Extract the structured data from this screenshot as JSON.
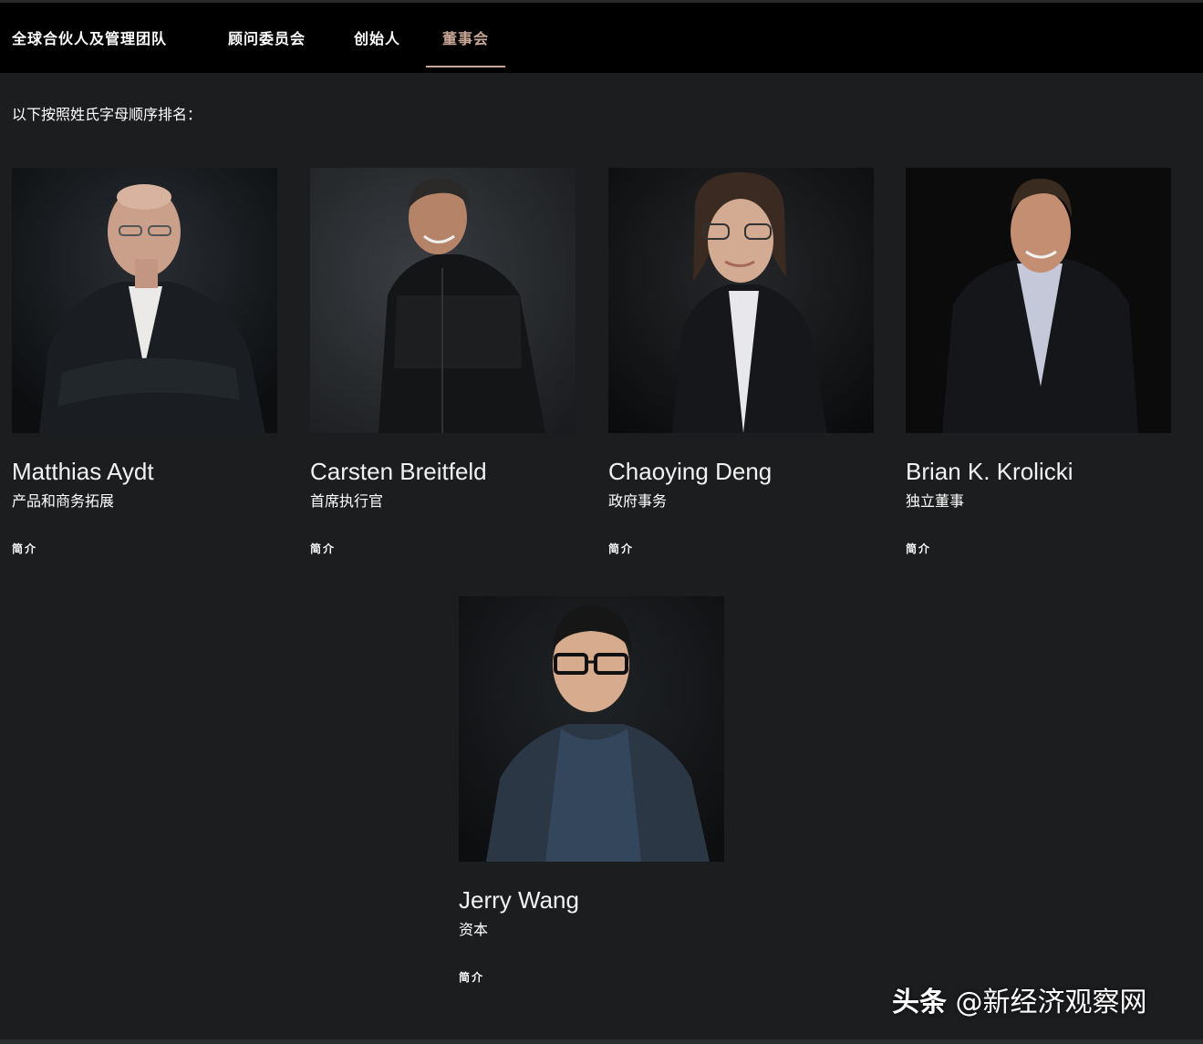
{
  "nav": {
    "tabs": [
      {
        "label": "全球合伙人及管理团队",
        "active": false
      },
      {
        "label": "顾问委员会",
        "active": false
      },
      {
        "label": "创始人",
        "active": false
      },
      {
        "label": "董事会",
        "active": true
      }
    ],
    "accent_color": "#c9a796"
  },
  "intro": "以下按照姓氏字母顺序排名：",
  "members": [
    {
      "name": "Matthias Aydt",
      "role": "产品和商务拓展",
      "bio_link": "简介"
    },
    {
      "name": "Carsten Breitfeld",
      "role": "首席执行官",
      "bio_link": "简介"
    },
    {
      "name": "Chaoying Deng",
      "role": "政府事务",
      "bio_link": "简介"
    },
    {
      "name": "Brian K. Krolicki",
      "role": "独立董事",
      "bio_link": "简介"
    },
    {
      "name": "Jerry Wang",
      "role": "资本",
      "bio_link": "简介"
    }
  ],
  "watermark": {
    "brand": "头条",
    "account": "@新经济观察网"
  },
  "colors": {
    "page_background": "#1c1d1f",
    "nav_background": "#000000"
  }
}
